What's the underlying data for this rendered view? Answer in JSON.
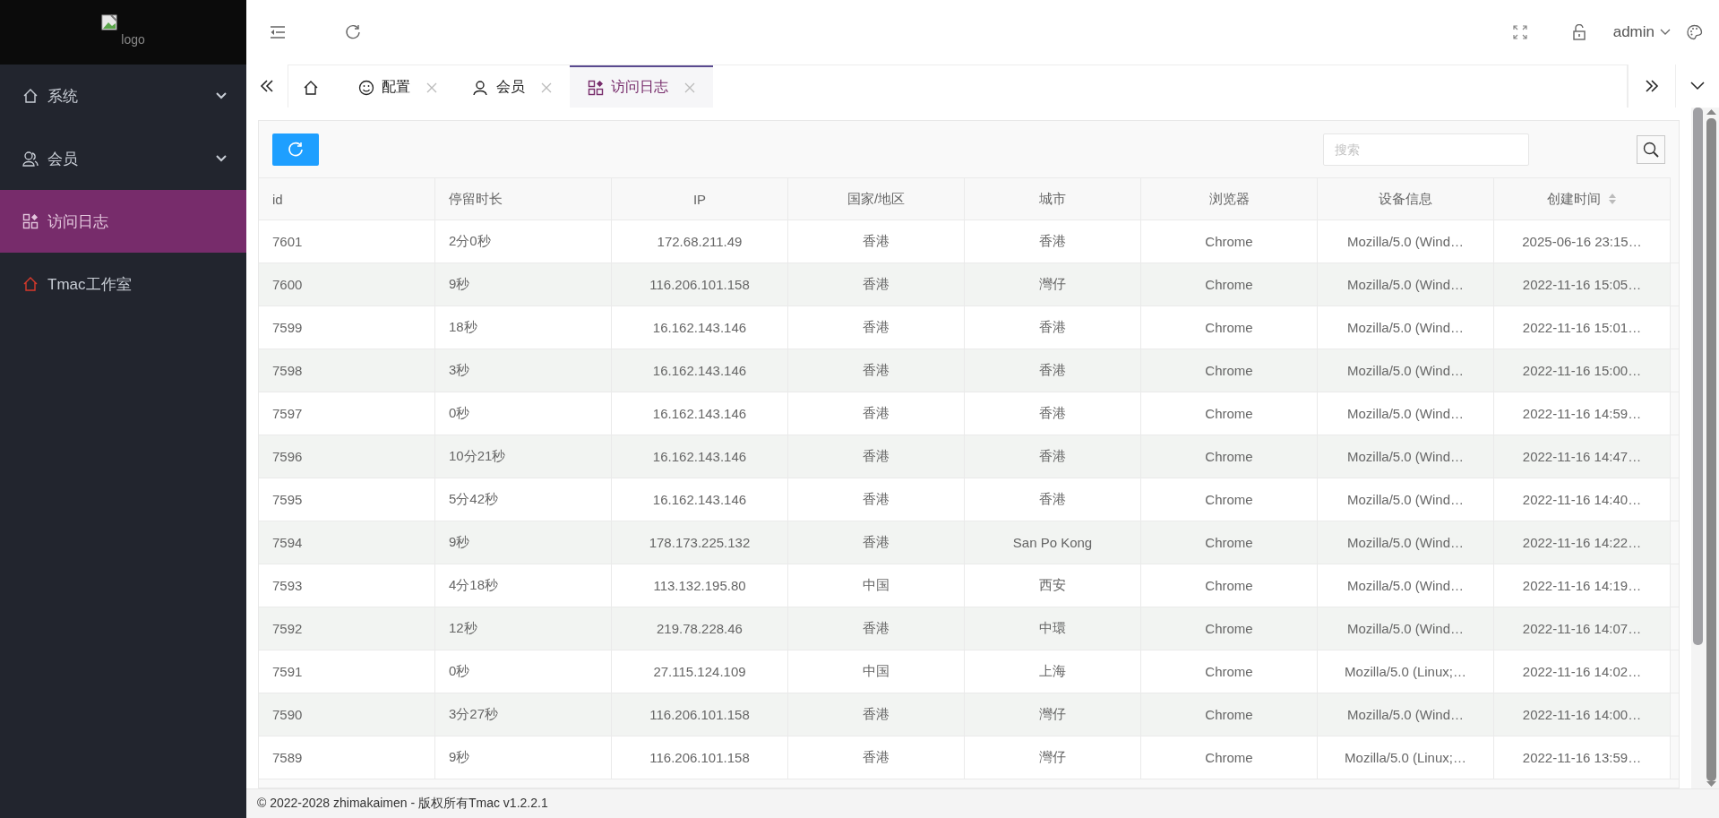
{
  "logo": {
    "alt": "logo"
  },
  "sidebar": {
    "items": [
      {
        "label": "系统",
        "kind": "group",
        "selected": false
      },
      {
        "label": "会员",
        "kind": "group",
        "selected": false
      },
      {
        "label": "访问日志",
        "kind": "link",
        "selected": true
      },
      {
        "label": "Tmac工作室",
        "kind": "link",
        "selected": false
      }
    ]
  },
  "header": {
    "user": "admin"
  },
  "home_tab": {
    "selected": false
  },
  "tabs": [
    {
      "label": "配置",
      "selected": false
    },
    {
      "label": "会员",
      "selected": false
    },
    {
      "label": "访问日志",
      "selected": true
    }
  ],
  "search": {
    "placeholder": "搜索"
  },
  "table": {
    "columns": [
      {
        "label": "id",
        "sortable": false
      },
      {
        "label": "停留时长",
        "sortable": false
      },
      {
        "label": "IP",
        "sortable": false
      },
      {
        "label": "国家/地区",
        "sortable": false
      },
      {
        "label": "城市",
        "sortable": false
      },
      {
        "label": "浏览器",
        "sortable": false
      },
      {
        "label": "设备信息",
        "sortable": false
      },
      {
        "label": "创建时间",
        "sortable": true
      }
    ],
    "rows": [
      [
        "7601",
        "2分0秒",
        "172.68.211.49",
        "香港",
        "香港",
        "Chrome",
        "Mozilla/5.0 (Wind…",
        "2025-06-16 23:15…"
      ],
      [
        "7600",
        "9秒",
        "116.206.101.158",
        "香港",
        "灣仔",
        "Chrome",
        "Mozilla/5.0 (Wind…",
        "2022-11-16 15:05…"
      ],
      [
        "7599",
        "18秒",
        "16.162.143.146",
        "香港",
        "香港",
        "Chrome",
        "Mozilla/5.0 (Wind…",
        "2022-11-16 15:01…"
      ],
      [
        "7598",
        "3秒",
        "16.162.143.146",
        "香港",
        "香港",
        "Chrome",
        "Mozilla/5.0 (Wind…",
        "2022-11-16 15:00…"
      ],
      [
        "7597",
        "0秒",
        "16.162.143.146",
        "香港",
        "香港",
        "Chrome",
        "Mozilla/5.0 (Wind…",
        "2022-11-16 14:59…"
      ],
      [
        "7596",
        "10分21秒",
        "16.162.143.146",
        "香港",
        "香港",
        "Chrome",
        "Mozilla/5.0 (Wind…",
        "2022-11-16 14:47…"
      ],
      [
        "7595",
        "5分42秒",
        "16.162.143.146",
        "香港",
        "香港",
        "Chrome",
        "Mozilla/5.0 (Wind…",
        "2022-11-16 14:40…"
      ],
      [
        "7594",
        "9秒",
        "178.173.225.132",
        "香港",
        "San Po Kong",
        "Chrome",
        "Mozilla/5.0 (Wind…",
        "2022-11-16 14:22…"
      ],
      [
        "7593",
        "4分18秒",
        "113.132.195.80",
        "中国",
        "西安",
        "Chrome",
        "Mozilla/5.0 (Wind…",
        "2022-11-16 14:19…"
      ],
      [
        "7592",
        "12秒",
        "219.78.228.46",
        "香港",
        "中環",
        "Chrome",
        "Mozilla/5.0 (Wind…",
        "2022-11-16 14:07…"
      ],
      [
        "7591",
        "0秒",
        "27.115.124.109",
        "中国",
        "上海",
        "Chrome",
        "Mozilla/5.0 (Linux;…",
        "2022-11-16 14:02…"
      ],
      [
        "7590",
        "3分27秒",
        "116.206.101.158",
        "香港",
        "灣仔",
        "Chrome",
        "Mozilla/5.0 (Wind…",
        "2022-11-16 14:00…"
      ],
      [
        "7589",
        "9秒",
        "116.206.101.158",
        "香港",
        "灣仔",
        "Chrome",
        "Mozilla/5.0 (Linux;…",
        "2022-11-16 13:59…"
      ]
    ]
  },
  "footer": "© 2022-2028 zhimakaimen - 版权所有Tmac v1.2.2.1"
}
